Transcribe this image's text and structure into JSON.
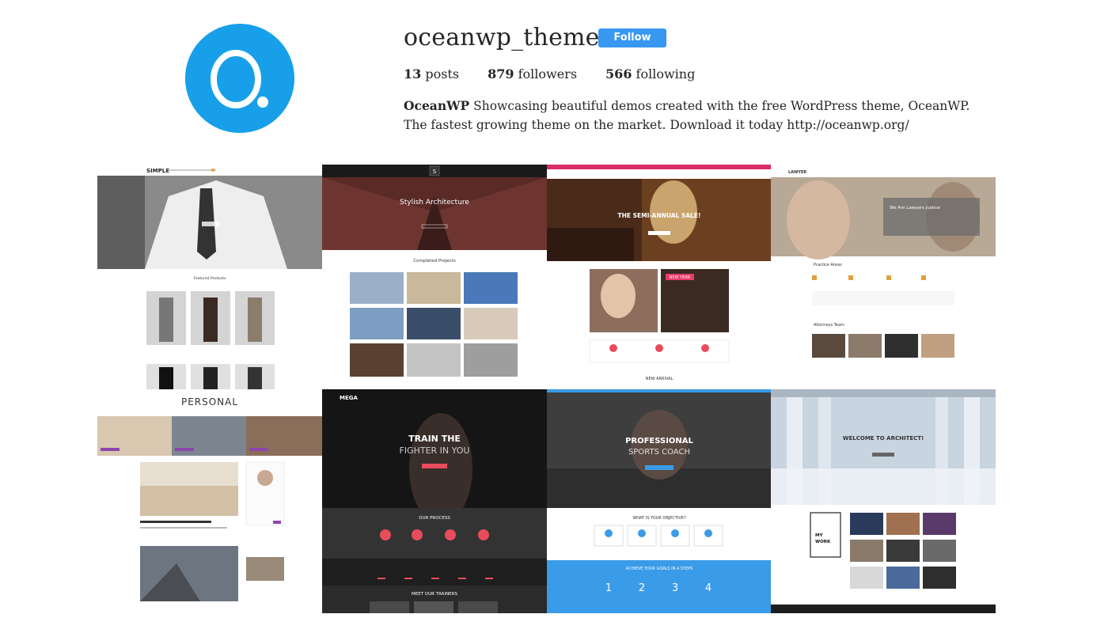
{
  "profile": {
    "username": "oceanwp_theme",
    "follow_label": "Follow",
    "posts_count": "13",
    "posts_label": "posts",
    "followers_count": "879",
    "followers_label": "followers",
    "following_count": "566",
    "following_label": "following",
    "bio_name": "OceanWP",
    "bio_text": " Showcasing beautiful demos created with the free WordPress theme, OceanWP. The fastest growing theme on the market. Download it today http://oceanwp.org/"
  },
  "colors": {
    "accent": "#3897f0",
    "avatar": "#17a0e9"
  },
  "posts": [
    {
      "logo": "SIMPLE",
      "section": "Featured Products"
    },
    {
      "logo": "S",
      "hero": "Stylish Architecture",
      "section": "Completed Projects"
    },
    {
      "hero": "THE SEMI-ANNUAL SALE!",
      "badge": "NEW YEAR",
      "section": "NEW ARRIVAL"
    },
    {
      "logo": "LAWYER",
      "hero": "We Are Lawyers Justice",
      "section1": "Practice Areas",
      "section2": "Attorneys Team"
    },
    {
      "logo": "PERSONAL"
    },
    {
      "logo": "MEGA",
      "hero1": "TRAIN THE",
      "hero2": "FIGHTER IN YOU",
      "section1": "OUR PROCESS",
      "section2": "MEET OUR TRAINERS"
    },
    {
      "hero1": "PROFESSIONAL",
      "hero2": "SPORTS COACH",
      "section1": "WHAT IS YOUR OBJECTIVE?",
      "section2": "ACHIEVE YOUR GOALS IN 4 STEPS",
      "steps": [
        "1",
        "2",
        "3",
        "4"
      ]
    },
    {
      "hero": "WELCOME TO ARCHITECT!",
      "box1": "MY",
      "box2": "WORK"
    }
  ]
}
